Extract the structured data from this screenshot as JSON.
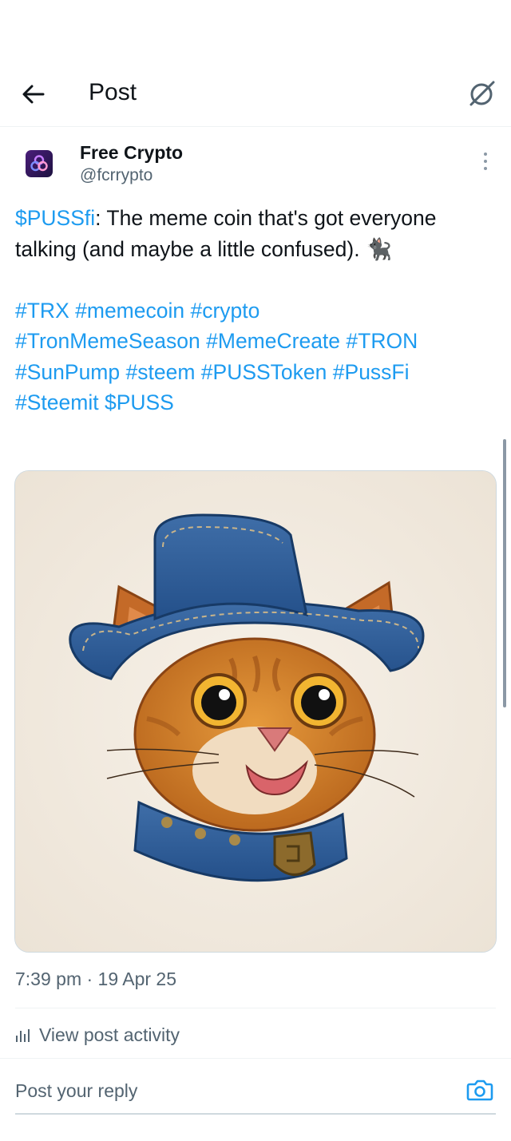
{
  "header": {
    "title": "Post",
    "back_icon": "arrow-left-icon",
    "grok_icon": "grok-icon"
  },
  "author": {
    "name": "Free Crypto",
    "handle": "@fcrrypto",
    "more_icon": "more-vertical-icon"
  },
  "post": {
    "cashtag": "$PUSSfi",
    "text_line": ": The meme coin that's got everyone talking (and maybe a little confused). ",
    "emoji": "🐈‍⬛",
    "hashtags": [
      "#TRX",
      "#memecoin",
      "#crypto",
      "#TronMemeSeason",
      "#MemeCreate",
      "#TRON",
      "#SunPump",
      "#steem",
      "#PUSSToken",
      "#PussFi",
      "#Steemit",
      "$PUSS"
    ]
  },
  "meta": {
    "timestamp": "7:39 pm · 19 Apr 25",
    "activity_label": "View post activity"
  },
  "reply": {
    "placeholder": "Post your reply",
    "camera_icon": "camera-icon"
  },
  "colors": {
    "link": "#1d9bf0",
    "text": "#0f1419",
    "secondary": "#536471"
  }
}
